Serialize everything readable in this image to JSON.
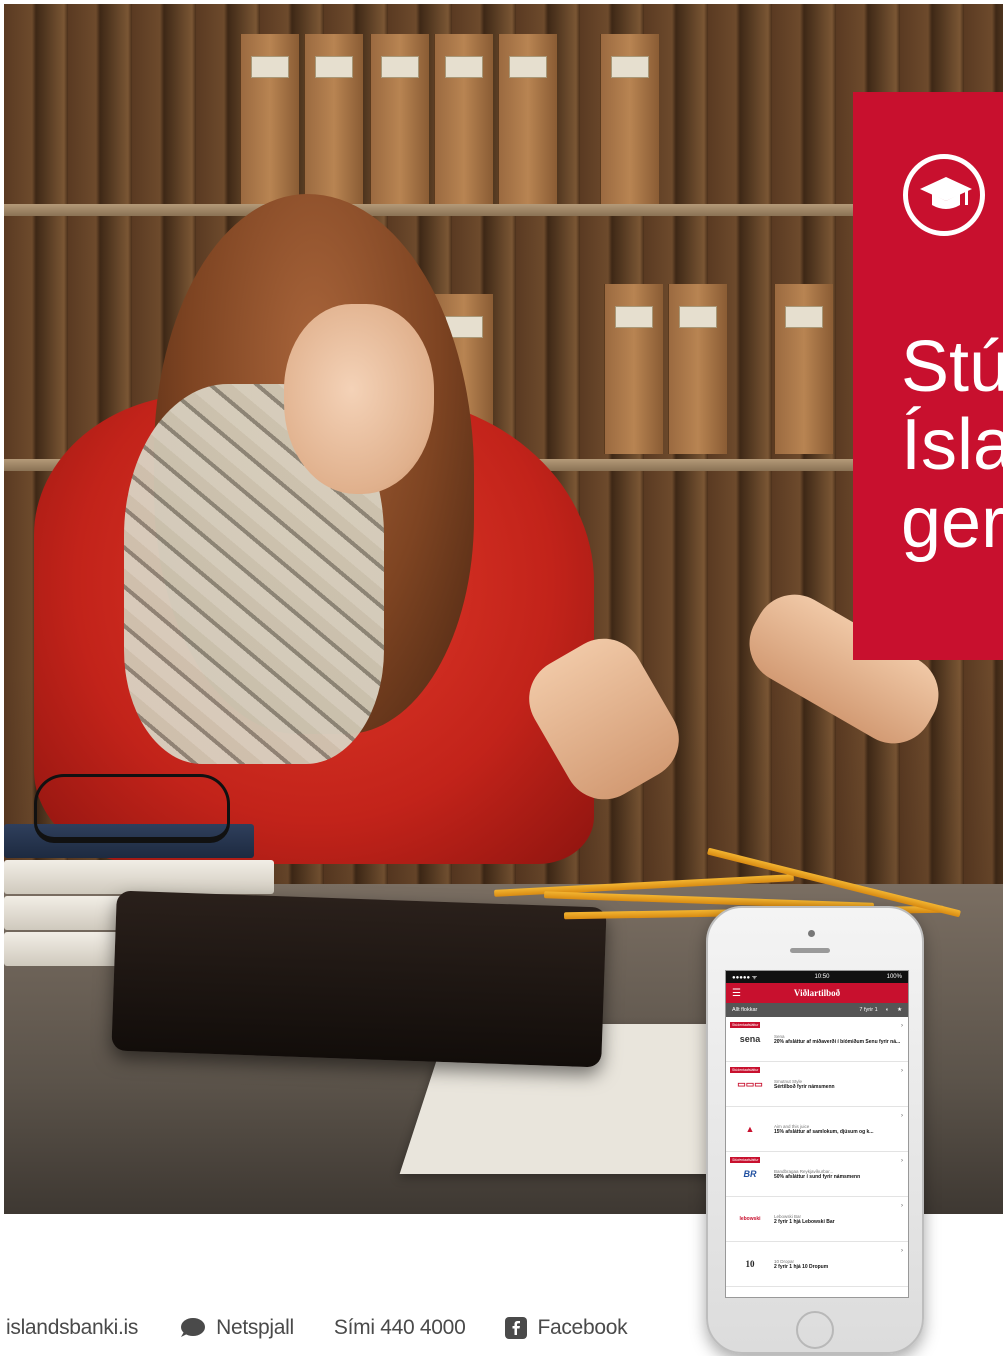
{
  "banner": {
    "title_lines": [
      "Stú",
      "Ísla",
      "ger"
    ],
    "icon": "graduation-cap-icon",
    "accent_color": "#c8102e"
  },
  "phone": {
    "status_left": "●●●●● ᯤ",
    "status_time": "10:50",
    "status_right": "100%",
    "app_title": "Viðlartilboð",
    "filter_left": "Allt flokkar",
    "filter_right": "7 fyrir 1",
    "offers": [
      {
        "tag": "Stúdentaafsláttur",
        "logo": "sena",
        "merchant": "Sena",
        "desc": "20% afsláttur af miðaverði í bíómiðum Senu fyrir ná..."
      },
      {
        "tag": "Stúdentaafsláttur",
        "logo": "▭▭▭",
        "merchant": "Smutnut Style",
        "desc": "Sértilboð fyrir námsmenn"
      },
      {
        "tag": "",
        "logo": "▲",
        "merchant": "Aim and this juice",
        "desc": "15% afsláttur af samlokum, djúsum og k..."
      },
      {
        "tag": "Stúdentaafsláttur",
        "logo": "BR",
        "merchant": "Bandbragaa Reykjavíkurbar...",
        "desc": "50% afsláttur í sund fyrir námsmenn"
      },
      {
        "tag": "",
        "logo": "lebowski",
        "merchant": "Lebowski Bar",
        "desc": "2 fyrir 1 hjá Lebowski Bar"
      },
      {
        "tag": "",
        "logo": "10",
        "merchant": "10 Dropar",
        "desc": "2 fyrir 1 hjá 10 Dropum"
      }
    ]
  },
  "footer": {
    "website": "islandsbanki.is",
    "chat_label": "Netspjall",
    "chat_icon": "chat-bubble-icon",
    "phone_label": "Sími 440 4000",
    "facebook_label": "Facebook",
    "facebook_icon": "facebook-icon"
  }
}
